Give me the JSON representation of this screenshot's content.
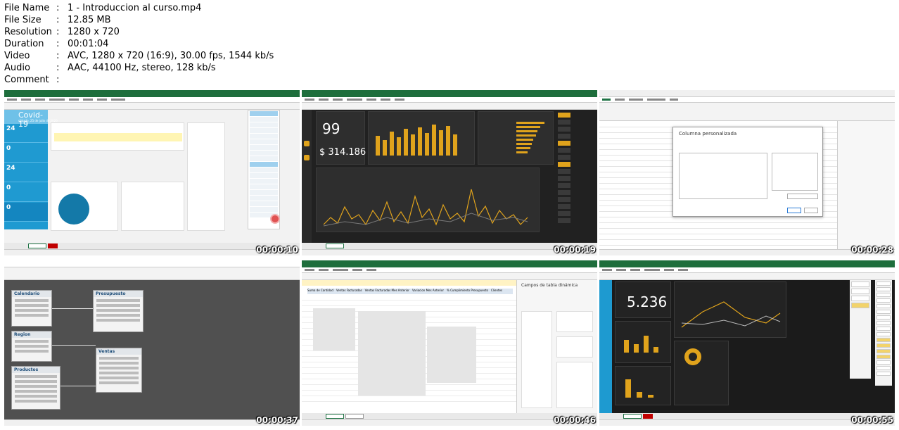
{
  "file_info": [
    {
      "key": "File Name",
      "value": "1 - Introduccion al curso.mp4"
    },
    {
      "key": "File Size",
      "value": "12.85 MB"
    },
    {
      "key": "Resolution",
      "value": "1280 x 720"
    },
    {
      "key": "Duration",
      "value": "00:01:04"
    },
    {
      "key": "Video",
      "value": "AVC, 1280 x 720 (16:9), 30.00 fps, 1544 kb/s"
    },
    {
      "key": "Audio",
      "value": "AAC, 44100 Hz, stereo, 128 kb/s"
    },
    {
      "key": "Comment",
      "value": ""
    }
  ],
  "separator": ":",
  "thumbnails": [
    {
      "timestamp": "00:00:10",
      "app": "Excel - Covid dashboard",
      "text": {
        "title": "Covid-19",
        "date": "sábado, 25 de julio de 2020",
        "k1": "24",
        "k2": "0",
        "k3": "24",
        "k4": "0",
        "k5": "0",
        "sheet": "Dashboard"
      }
    },
    {
      "timestamp": "00:00:19",
      "app": "Excel - Sales dashboard dark",
      "text": {
        "clientes": "99",
        "ventas": "$ 314.186",
        "sheet": "Dashboard"
      }
    },
    {
      "timestamp": "00:00:28",
      "app": "Power Query Editor",
      "text": {
        "dialog": "Columna personalizada"
      }
    },
    {
      "timestamp": "00:00:37",
      "app": "Power Pivot data model",
      "text": {
        "t1": "Calendario",
        "t2": "Presupuesto",
        "t3": "Region",
        "t4": "Ventas",
        "t5": "Productos"
      }
    },
    {
      "timestamp": "00:00:46",
      "app": "Excel - Pivot table",
      "text": {
        "pivot": "Campos de tabla dinámica",
        "h1": "Suma de Cantidad",
        "h2": "Ventas Facturadas",
        "h3": "Ventas Facturadas Mes Anterior",
        "h4": "Variacion Mes Anterior",
        "h5": "% Cumplimiento Presupuesto",
        "h6": "Clientes"
      }
    },
    {
      "timestamp": "00:00:55",
      "app": "Excel - Dark dashboard",
      "text": {
        "kpi": "5.236",
        "sheet": "Dashboard"
      }
    }
  ]
}
